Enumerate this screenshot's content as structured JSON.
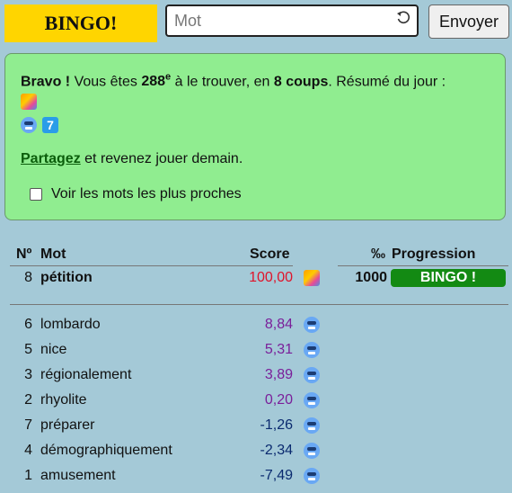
{
  "header": {
    "logo": "BINGO!",
    "input_placeholder": "Mot",
    "submit_label": "Envoyer"
  },
  "result": {
    "bravo": "Bravo !",
    "text_before_rank": "Vous êtes",
    "rank": "288",
    "rank_suffix": "e",
    "text_after_rank": "à le trouver, en",
    "coups": "8 coups",
    "summary": ". Résumé du jour :",
    "summary_count": "7",
    "share_link": "Partagez",
    "share_text": "et revenez jouer demain.",
    "checkbox_label": "Voir les mots les plus proches"
  },
  "table": {
    "headers": {
      "num": "Nº",
      "mot": "Mot",
      "score": "Score",
      "permille": "‰",
      "progression": "Progression"
    },
    "winner": {
      "num": "8",
      "word": "pétition",
      "score": "100,00",
      "progress": "1000",
      "bingo": "BINGO !"
    },
    "rows": [
      {
        "num": "6",
        "word": "lombardo",
        "score": "8,84"
      },
      {
        "num": "5",
        "word": "nice",
        "score": "5,31"
      },
      {
        "num": "3",
        "word": "régionalement",
        "score": "3,89"
      },
      {
        "num": "2",
        "word": "rhyolite",
        "score": "0,20"
      },
      {
        "num": "7",
        "word": "préparer",
        "score": "-1,26"
      },
      {
        "num": "4",
        "word": "démographiquement",
        "score": "-2,34"
      },
      {
        "num": "1",
        "word": "amusement",
        "score": "-7,49"
      }
    ]
  }
}
